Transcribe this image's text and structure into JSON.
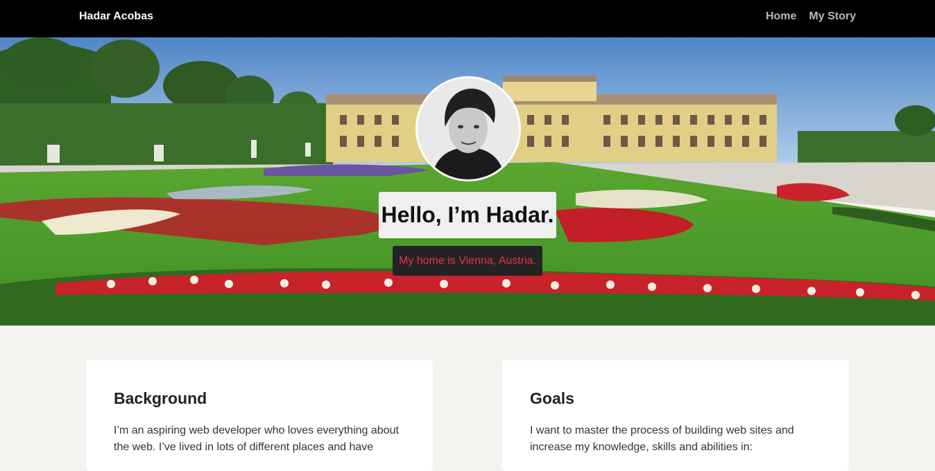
{
  "nav": {
    "brand": "Hadar Acobas",
    "links": [
      "Home",
      "My Story"
    ]
  },
  "hero": {
    "title": "Hello, I’m Hadar.",
    "subtitle": "My home is Vienna, Austria."
  },
  "cards": [
    {
      "heading": "Background",
      "text": "I’m an aspiring web developer who loves everything about the web. I’ve lived in lots of different places and have"
    },
    {
      "heading": "Goals",
      "text": "I want to master the process of building web sites and increase my knowledge, skills and abilities in:"
    }
  ],
  "colors": {
    "navbar": "#000000",
    "page_bg": "#f4f3ef",
    "subtitle_text": "#e0324b",
    "subtitle_bg": "#242424"
  }
}
